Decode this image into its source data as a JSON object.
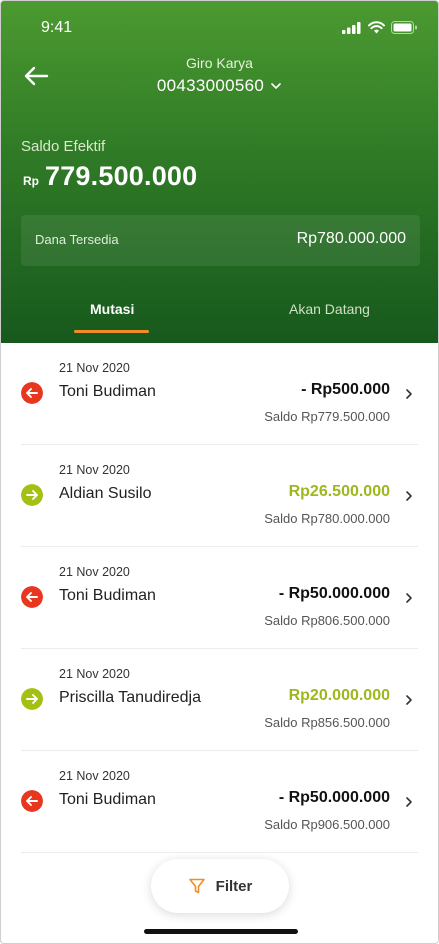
{
  "status": {
    "time": "9:41",
    "icons": [
      "signal-icon",
      "wifi-icon",
      "battery-icon"
    ]
  },
  "account": {
    "type": "Giro Karya",
    "number": "00433000560"
  },
  "balance": {
    "label": "Saldo Efektif",
    "currency": "Rp",
    "amount": "779.500.000"
  },
  "available": {
    "label": "Dana Tersedia",
    "amount": "Rp780.000.000"
  },
  "tabs": [
    {
      "label": "Mutasi",
      "active": true
    },
    {
      "label": "Akan Datang",
      "active": false
    }
  ],
  "transactions": [
    {
      "date": "21 Nov 2020",
      "name": "Toni Budiman",
      "amount": "- Rp500.000",
      "direction": "out",
      "balance": "Saldo Rp779.500.000"
    },
    {
      "date": "21 Nov 2020",
      "name": "Aldian Susilo",
      "amount": "Rp26.500.000",
      "direction": "in",
      "balance": "Saldo Rp780.000.000"
    },
    {
      "date": "21 Nov 2020",
      "name": "Toni Budiman",
      "amount": "- Rp50.000.000",
      "direction": "out",
      "balance": "Saldo Rp806.500.000"
    },
    {
      "date": "21 Nov 2020",
      "name": "Priscilla Tanudiredja",
      "amount": "Rp20.000.000",
      "direction": "in",
      "balance": "Saldo Rp856.500.000"
    },
    {
      "date": "21 Nov 2020",
      "name": "Toni Budiman",
      "amount": "- Rp50.000.000",
      "direction": "out",
      "balance": "Saldo Rp906.500.000"
    }
  ],
  "filter": {
    "label": "Filter"
  },
  "colors": {
    "header_top": "#4c9a31",
    "header_bottom": "#17591d",
    "accent": "#f28c28",
    "out": "#e8361f",
    "in": "#a5bf12"
  }
}
